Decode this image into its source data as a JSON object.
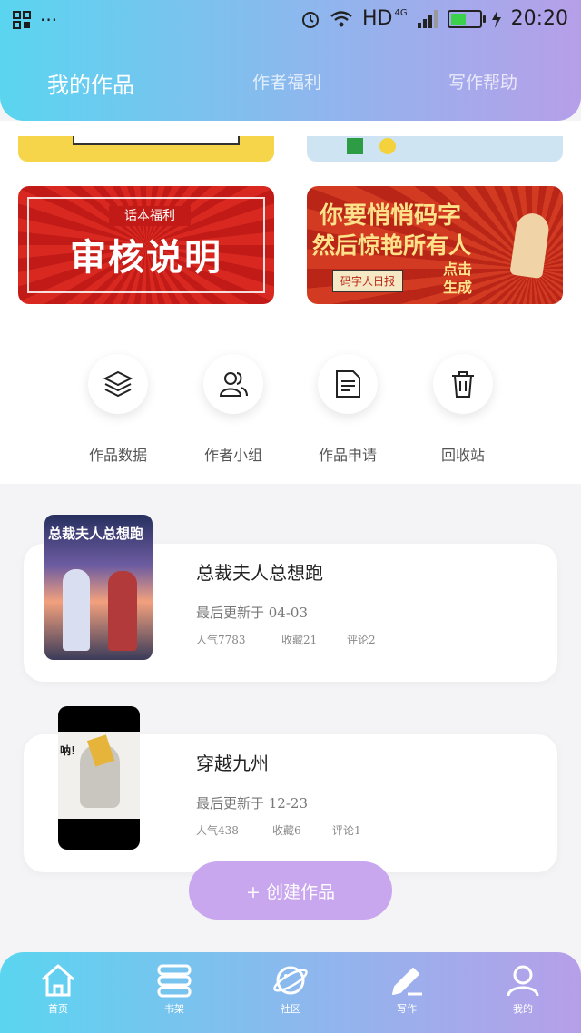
{
  "status_bar": {
    "network": "HD",
    "signal": "4G",
    "time": "20:20",
    "battery_level": 0.55,
    "left_dots": "···"
  },
  "tabs": [
    {
      "label": "我的作品",
      "active": true
    },
    {
      "label": "作者福利",
      "active": false
    },
    {
      "label": "写作帮助",
      "active": false
    }
  ],
  "banners": {
    "audit": {
      "small": "话本福利",
      "big": "审核说明"
    },
    "promo": {
      "line1": "你要悄悄码字",
      "line2": "然后惊艳所有人",
      "badge": "码字人日报",
      "action_line1": "点击",
      "action_line2": "生成"
    }
  },
  "quick_actions": [
    {
      "label": "作品数据",
      "icon": "layers-icon"
    },
    {
      "label": "作者小组",
      "icon": "users-icon"
    },
    {
      "label": "作品申请",
      "icon": "document-icon"
    },
    {
      "label": "回收站",
      "icon": "trash-icon"
    }
  ],
  "works": [
    {
      "title": "总裁夫人总想跑",
      "updated": "最后更新于 04-03",
      "popularity": "人气7783",
      "favorites": "收藏21",
      "comments": "评论2",
      "cover_text": "总裁夫人总想跑"
    },
    {
      "title": "穿越九州",
      "updated": "最后更新于 12-23",
      "popularity": "人气438",
      "favorites": "收藏6",
      "comments": "评论1",
      "cover_text": "呐!"
    }
  ],
  "create_button": "+ 创建作品",
  "bottom_nav": [
    {
      "label": "首页",
      "icon": "home-icon"
    },
    {
      "label": "书架",
      "icon": "bookshelf-icon"
    },
    {
      "label": "社区",
      "icon": "planet-icon"
    },
    {
      "label": "写作",
      "icon": "pen-icon",
      "active": true
    },
    {
      "label": "我的",
      "icon": "profile-icon"
    }
  ],
  "colors": {
    "gradient_start": "#5ad5f0",
    "gradient_end": "#b69fe9",
    "create_button": "#c9a7ee"
  }
}
